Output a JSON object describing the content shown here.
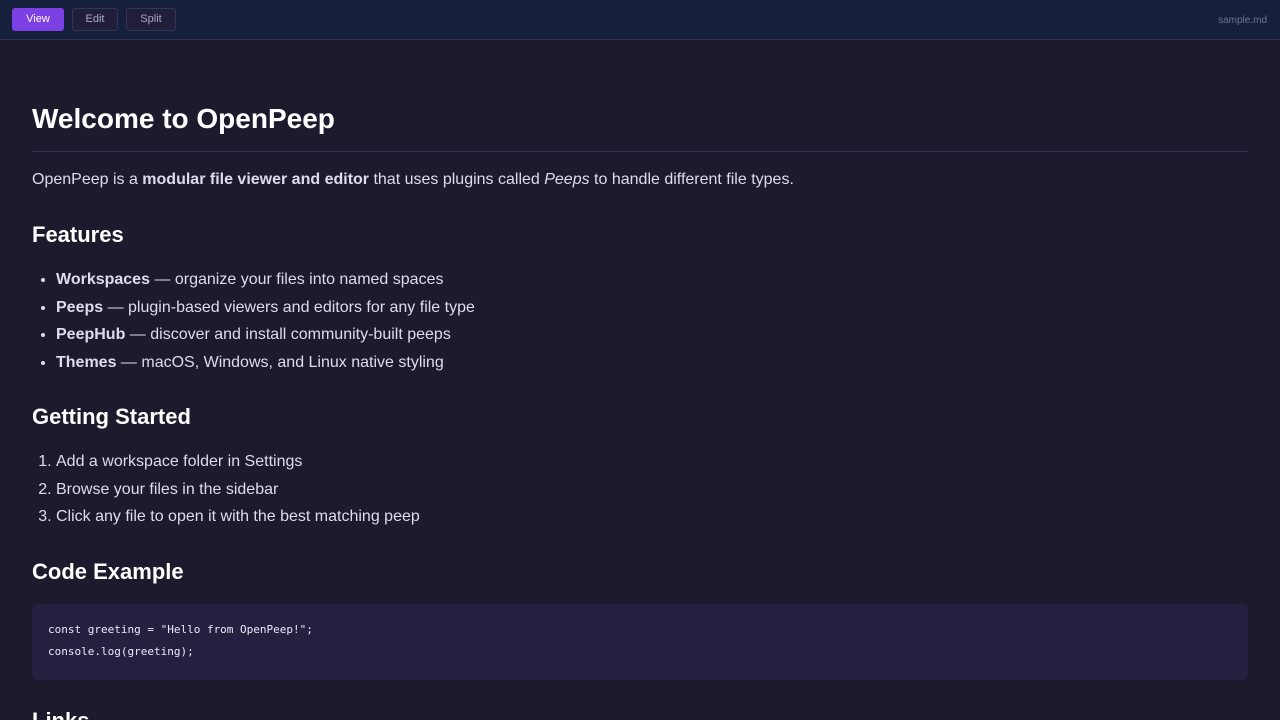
{
  "toolbar": {
    "modes": [
      {
        "label": "View",
        "active": true
      },
      {
        "label": "Edit",
        "active": false
      },
      {
        "label": "Split",
        "active": false
      }
    ],
    "filename": "sample.md"
  },
  "doc": {
    "title": "Welcome to OpenPeep",
    "intro": {
      "before": "OpenPeep is a ",
      "bold": "modular file viewer and editor",
      "middle": " that uses plugins called ",
      "italic": "Peeps",
      "after": " to handle different file types."
    },
    "features_heading": "Features",
    "features": [
      {
        "term": "Workspaces",
        "desc": " — organize your files into named spaces"
      },
      {
        "term": "Peeps",
        "desc": " — plugin-based viewers and editors for any file type"
      },
      {
        "term": "PeepHub",
        "desc": " — discover and install community-built peeps"
      },
      {
        "term": "Themes",
        "desc": " — macOS, Windows, and Linux native styling"
      }
    ],
    "getting_started_heading": "Getting Started",
    "steps": [
      "Add a workspace folder in Settings",
      "Browse your files in the sidebar",
      "Click any file to open it with the best matching peep"
    ],
    "code_heading": "Code Example",
    "code_lines": [
      "const greeting = \"Hello from OpenPeep!\";",
      "console.log(greeting);"
    ],
    "links_heading": "Links"
  },
  "colors": {
    "accent": "#7b3fe4",
    "background": "#1c1b2e",
    "toolbar": "#16203c",
    "code_background": "#23213f"
  }
}
